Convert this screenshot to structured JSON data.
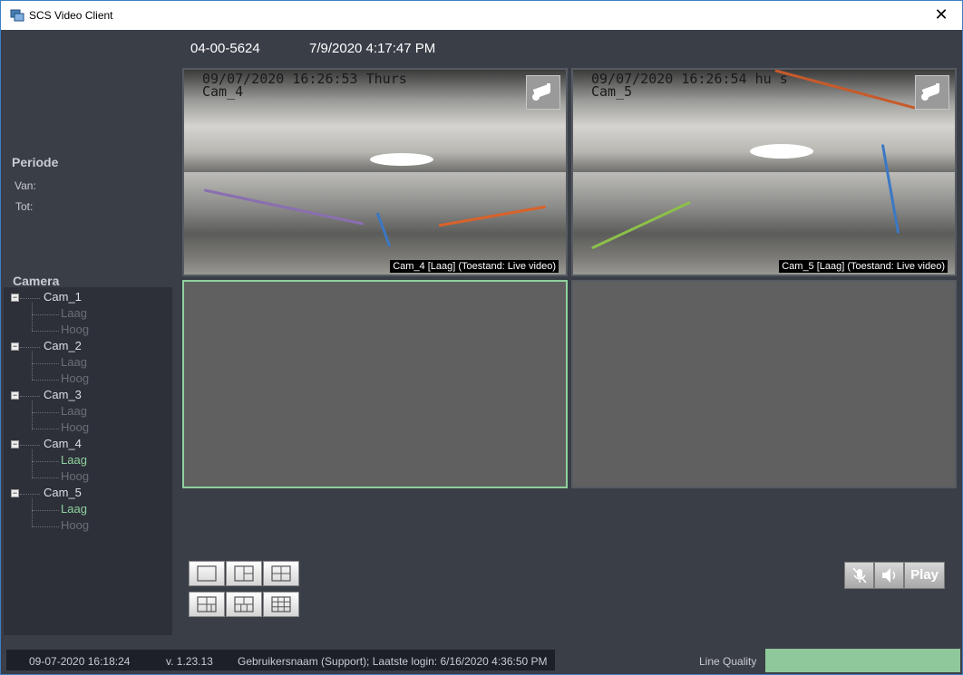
{
  "window": {
    "title": "SCS Video Client",
    "close_glyph": "✕"
  },
  "header": {
    "id": "04-00-5624",
    "datetime": "7/9/2020 4:17:47 PM"
  },
  "sidebar": {
    "periode_label": "Periode",
    "van_label": "Van:",
    "tot_label": "Tot:",
    "camera_label": "Camera",
    "cameras": [
      {
        "name": "Cam_1",
        "streams": [
          {
            "label": "Laag",
            "active": false
          },
          {
            "label": "Hoog",
            "active": false
          }
        ]
      },
      {
        "name": "Cam_2",
        "streams": [
          {
            "label": "Laag",
            "active": false
          },
          {
            "label": "Hoog",
            "active": false
          }
        ]
      },
      {
        "name": "Cam_3",
        "streams": [
          {
            "label": "Laag",
            "active": false
          },
          {
            "label": "Hoog",
            "active": false
          }
        ]
      },
      {
        "name": "Cam_4",
        "streams": [
          {
            "label": "Laag",
            "active": true
          },
          {
            "label": "Hoog",
            "active": false
          }
        ]
      },
      {
        "name": "Cam_5",
        "streams": [
          {
            "label": "Laag",
            "active": true
          },
          {
            "label": "Hoog",
            "active": false
          }
        ]
      }
    ]
  },
  "tiles": [
    {
      "osd_line1": "09/07/2020 16:26:53 Thurs",
      "osd_line2": "Cam_4",
      "caption": "Cam_4 [Laag] (Toestand: Live video)",
      "icon": "camera-icon"
    },
    {
      "osd_line1": "09/07/2020 16:26:54 hu s",
      "osd_line2": "Cam_5",
      "caption": "Cam_5 [Laag] (Toestand: Live video)",
      "icon": "camera-icon"
    },
    {
      "selected": true
    },
    {
      "selected": false
    }
  ],
  "layout_buttons": [
    {
      "name": "layout-1x1-button",
      "icon": "single-view-icon"
    },
    {
      "name": "layout-1plus2-button",
      "icon": "one-plus-two-icon"
    },
    {
      "name": "layout-2x2-button",
      "icon": "quad-view-icon"
    },
    {
      "name": "layout-1plus3-button",
      "icon": "one-plus-three-icon"
    },
    {
      "name": "layout-2x3-button",
      "icon": "six-view-icon"
    },
    {
      "name": "layout-3x3-button",
      "icon": "nine-view-icon"
    }
  ],
  "controls": {
    "mute_icon": "microphone-muted-icon",
    "speaker_icon": "speaker-icon",
    "play_label": "Play"
  },
  "status": {
    "datetime": "09-07-2020 16:18:24",
    "version": "v. 1.23.13",
    "user_info": "Gebruikersnaam (Support); Laatste login: 6/16/2020 4:36:50 PM",
    "line_quality_label": "Line Quality",
    "line_quality_color": "#8fc89a"
  },
  "colors": {
    "background": "#3a3e47",
    "tree_background": "#2d3039",
    "active_stream": "#8fd19e",
    "inactive_stream": "#6a6e76"
  }
}
